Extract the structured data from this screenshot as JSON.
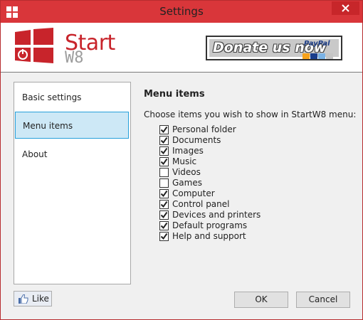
{
  "window": {
    "title": "Settings",
    "accent_color": "#d9363a"
  },
  "header": {
    "logo_word": "Start",
    "logo_suffix": "W8",
    "donate_label": "Donate us now",
    "paypal_label": "PayPal"
  },
  "sidebar": {
    "items": [
      {
        "label": "Basic settings",
        "selected": false
      },
      {
        "label": "Menu items",
        "selected": true
      },
      {
        "label": "About",
        "selected": false
      }
    ]
  },
  "panel": {
    "title": "Menu items",
    "description": "Choose items you wish to show in StartW8 menu:",
    "items": [
      {
        "label": "Personal folder",
        "checked": true
      },
      {
        "label": "Documents",
        "checked": true
      },
      {
        "label": "Images",
        "checked": true
      },
      {
        "label": "Music",
        "checked": true
      },
      {
        "label": "Videos",
        "checked": false
      },
      {
        "label": "Games",
        "checked": false
      },
      {
        "label": "Computer",
        "checked": true
      },
      {
        "label": "Control panel",
        "checked": true
      },
      {
        "label": "Devices and printers",
        "checked": true
      },
      {
        "label": "Default programs",
        "checked": true
      },
      {
        "label": "Help and support",
        "checked": true
      }
    ]
  },
  "footer": {
    "like_label": "Like",
    "ok_label": "OK",
    "cancel_label": "Cancel"
  }
}
